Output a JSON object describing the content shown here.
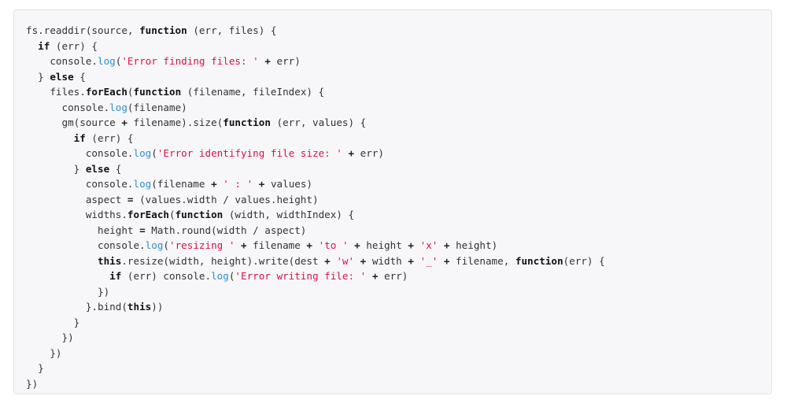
{
  "colors": {
    "background": "#ffffff",
    "code_background": "#f7f7f9",
    "code_border": "#dfe3e8",
    "text": "#333333",
    "keyword": "#111111",
    "method": "#2f8fcf",
    "string": "#dd1144"
  },
  "code": {
    "language": "javascript",
    "lines": [
      [
        {
          "t": "txt",
          "v": "fs.readdir(source, "
        },
        {
          "t": "kw",
          "v": "function"
        },
        {
          "t": "txt",
          "v": " (err, files) {"
        }
      ],
      [
        {
          "t": "txt",
          "v": "  "
        },
        {
          "t": "kw",
          "v": "if"
        },
        {
          "t": "txt",
          "v": " (err) {"
        }
      ],
      [
        {
          "t": "txt",
          "v": "    console."
        },
        {
          "t": "fn",
          "v": "log"
        },
        {
          "t": "txt",
          "v": "("
        },
        {
          "t": "str",
          "v": "'Error finding files: '"
        },
        {
          "t": "txt",
          "v": " "
        },
        {
          "t": "op",
          "v": "+"
        },
        {
          "t": "txt",
          "v": " err)"
        }
      ],
      [
        {
          "t": "txt",
          "v": "  } "
        },
        {
          "t": "kw",
          "v": "else"
        },
        {
          "t": "txt",
          "v": " {"
        }
      ],
      [
        {
          "t": "txt",
          "v": "    files."
        },
        {
          "t": "kw",
          "v": "forEach"
        },
        {
          "t": "txt",
          "v": "("
        },
        {
          "t": "kw",
          "v": "function"
        },
        {
          "t": "txt",
          "v": " (filename, fileIndex) {"
        }
      ],
      [
        {
          "t": "txt",
          "v": "      console."
        },
        {
          "t": "fn",
          "v": "log"
        },
        {
          "t": "txt",
          "v": "(filename)"
        }
      ],
      [
        {
          "t": "txt",
          "v": "      gm(source "
        },
        {
          "t": "op",
          "v": "+"
        },
        {
          "t": "txt",
          "v": " filename).size("
        },
        {
          "t": "kw",
          "v": "function"
        },
        {
          "t": "txt",
          "v": " (err, values) {"
        }
      ],
      [
        {
          "t": "txt",
          "v": "        "
        },
        {
          "t": "kw",
          "v": "if"
        },
        {
          "t": "txt",
          "v": " (err) {"
        }
      ],
      [
        {
          "t": "txt",
          "v": "          console."
        },
        {
          "t": "fn",
          "v": "log"
        },
        {
          "t": "txt",
          "v": "("
        },
        {
          "t": "str",
          "v": "'Error identifying file size: '"
        },
        {
          "t": "txt",
          "v": " "
        },
        {
          "t": "op",
          "v": "+"
        },
        {
          "t": "txt",
          "v": " err)"
        }
      ],
      [
        {
          "t": "txt",
          "v": "        } "
        },
        {
          "t": "kw",
          "v": "else"
        },
        {
          "t": "txt",
          "v": " {"
        }
      ],
      [
        {
          "t": "txt",
          "v": "          console."
        },
        {
          "t": "fn",
          "v": "log"
        },
        {
          "t": "txt",
          "v": "(filename "
        },
        {
          "t": "op",
          "v": "+"
        },
        {
          "t": "txt",
          "v": " "
        },
        {
          "t": "str",
          "v": "' : '"
        },
        {
          "t": "txt",
          "v": " "
        },
        {
          "t": "op",
          "v": "+"
        },
        {
          "t": "txt",
          "v": " values)"
        }
      ],
      [
        {
          "t": "txt",
          "v": "          aspect "
        },
        {
          "t": "op",
          "v": "="
        },
        {
          "t": "txt",
          "v": " (values.width / values.height)"
        }
      ],
      [
        {
          "t": "txt",
          "v": "          widths."
        },
        {
          "t": "kw",
          "v": "forEach"
        },
        {
          "t": "txt",
          "v": "("
        },
        {
          "t": "kw",
          "v": "function"
        },
        {
          "t": "txt",
          "v": " (width, widthIndex) {"
        }
      ],
      [
        {
          "t": "txt",
          "v": "            height "
        },
        {
          "t": "op",
          "v": "="
        },
        {
          "t": "txt",
          "v": " Math.round(width / aspect)"
        }
      ],
      [
        {
          "t": "txt",
          "v": "            console."
        },
        {
          "t": "fn",
          "v": "log"
        },
        {
          "t": "txt",
          "v": "("
        },
        {
          "t": "str",
          "v": "'resizing '"
        },
        {
          "t": "txt",
          "v": " "
        },
        {
          "t": "op",
          "v": "+"
        },
        {
          "t": "txt",
          "v": " filename "
        },
        {
          "t": "op",
          "v": "+"
        },
        {
          "t": "txt",
          "v": " "
        },
        {
          "t": "str",
          "v": "'to '"
        },
        {
          "t": "txt",
          "v": " "
        },
        {
          "t": "op",
          "v": "+"
        },
        {
          "t": "txt",
          "v": " height "
        },
        {
          "t": "op",
          "v": "+"
        },
        {
          "t": "txt",
          "v": " "
        },
        {
          "t": "str",
          "v": "'x'"
        },
        {
          "t": "txt",
          "v": " "
        },
        {
          "t": "op",
          "v": "+"
        },
        {
          "t": "txt",
          "v": " height)"
        }
      ],
      [
        {
          "t": "txt",
          "v": "            "
        },
        {
          "t": "kw",
          "v": "this"
        },
        {
          "t": "txt",
          "v": ".resize(width, height).write(dest "
        },
        {
          "t": "op",
          "v": "+"
        },
        {
          "t": "txt",
          "v": " "
        },
        {
          "t": "str",
          "v": "'w'"
        },
        {
          "t": "txt",
          "v": " "
        },
        {
          "t": "op",
          "v": "+"
        },
        {
          "t": "txt",
          "v": " width "
        },
        {
          "t": "op",
          "v": "+"
        },
        {
          "t": "txt",
          "v": " "
        },
        {
          "t": "str",
          "v": "'_'"
        },
        {
          "t": "txt",
          "v": " "
        },
        {
          "t": "op",
          "v": "+"
        },
        {
          "t": "txt",
          "v": " filename, "
        },
        {
          "t": "kw",
          "v": "function"
        },
        {
          "t": "txt",
          "v": "(err) {"
        }
      ],
      [
        {
          "t": "txt",
          "v": "              "
        },
        {
          "t": "kw",
          "v": "if"
        },
        {
          "t": "txt",
          "v": " (err) console."
        },
        {
          "t": "fn",
          "v": "log"
        },
        {
          "t": "txt",
          "v": "("
        },
        {
          "t": "str",
          "v": "'Error writing file: '"
        },
        {
          "t": "txt",
          "v": " "
        },
        {
          "t": "op",
          "v": "+"
        },
        {
          "t": "txt",
          "v": " err)"
        }
      ],
      [
        {
          "t": "txt",
          "v": "            })"
        }
      ],
      [
        {
          "t": "txt",
          "v": "          }.bind("
        },
        {
          "t": "kw",
          "v": "this"
        },
        {
          "t": "txt",
          "v": "))"
        }
      ],
      [
        {
          "t": "txt",
          "v": "        }"
        }
      ],
      [
        {
          "t": "txt",
          "v": "      })"
        }
      ],
      [
        {
          "t": "txt",
          "v": "    })"
        }
      ],
      [
        {
          "t": "txt",
          "v": "  }"
        }
      ],
      [
        {
          "t": "txt",
          "v": "})"
        }
      ]
    ]
  }
}
